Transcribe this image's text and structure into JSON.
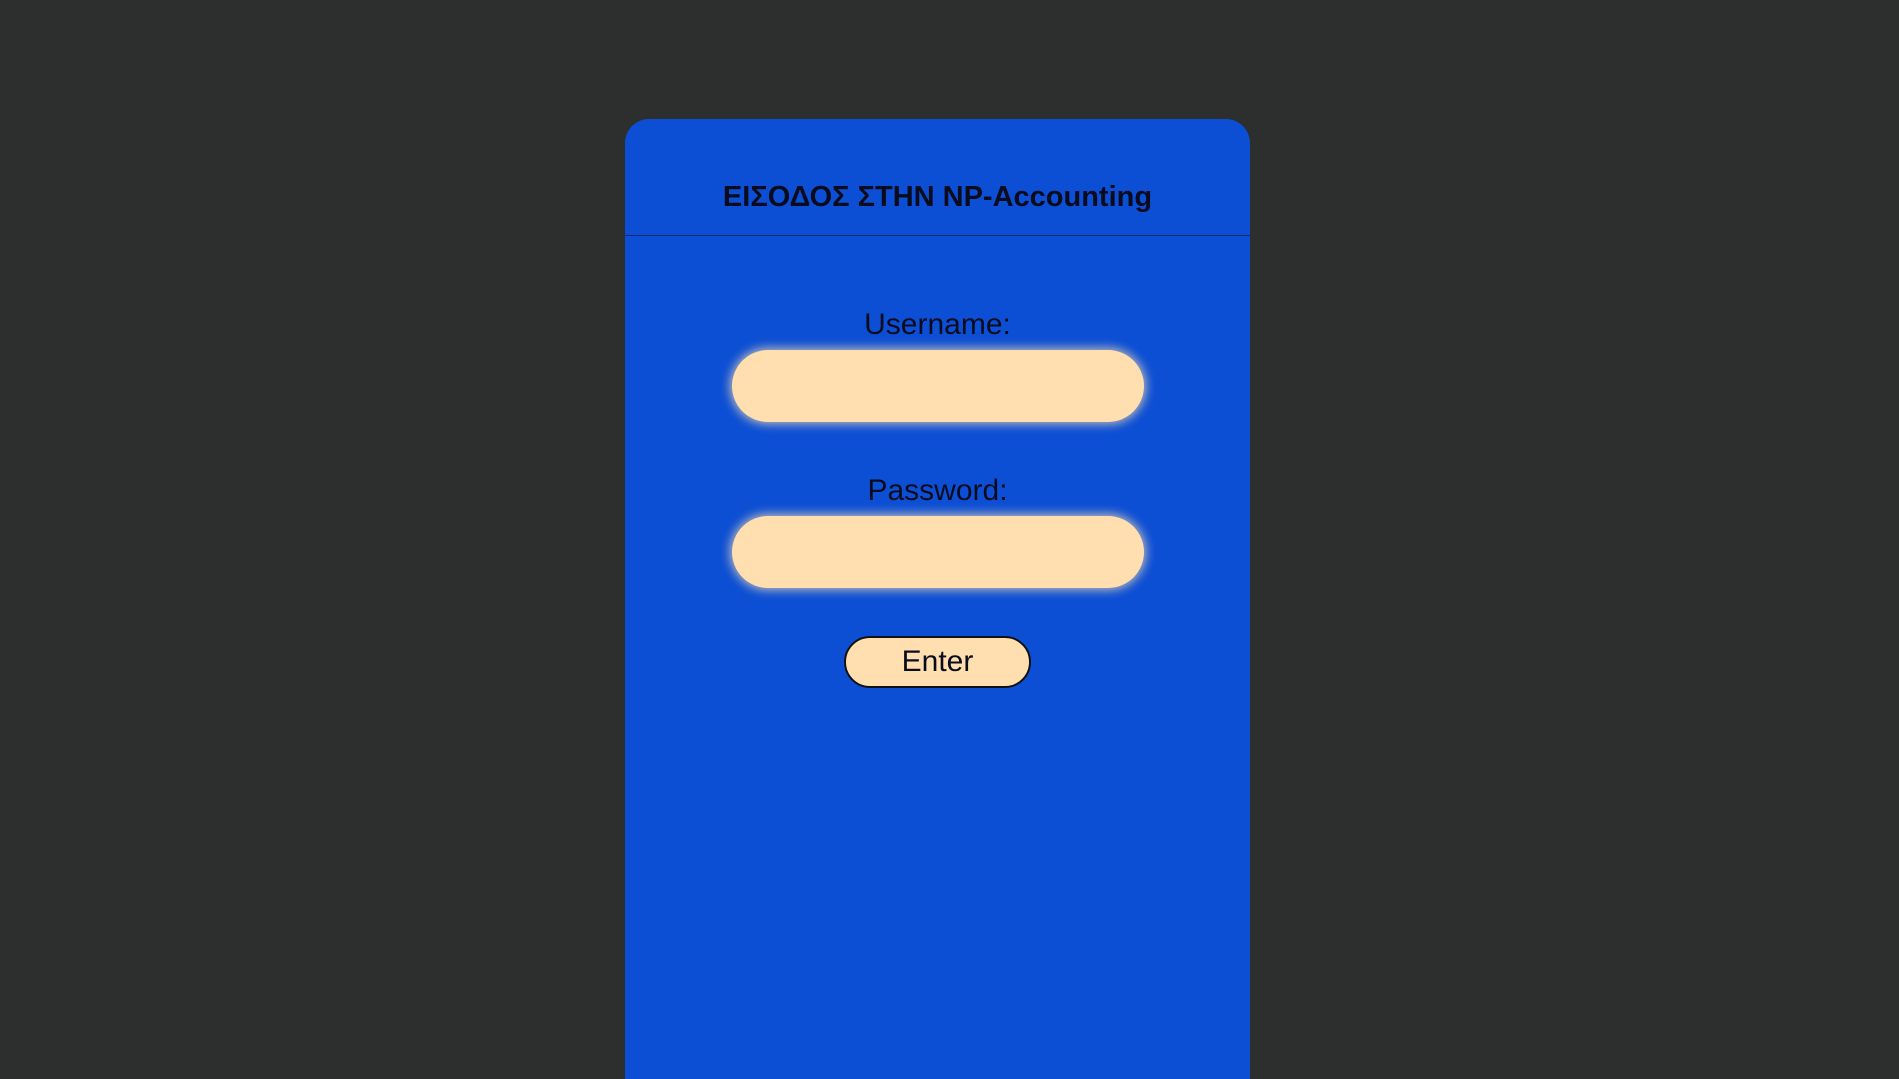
{
  "login": {
    "title": "ΕΙΣΟΔΟΣ ΣΤΗΝ NP-Accounting",
    "username_label": "Username:",
    "username_value": "",
    "password_label": "Password:",
    "password_value": "",
    "submit_label": "Enter"
  },
  "colors": {
    "background": "#2d2e2e",
    "card": "#0c4fd4",
    "input_fill": "#ffdfb0",
    "text": "#0b0b1e"
  }
}
